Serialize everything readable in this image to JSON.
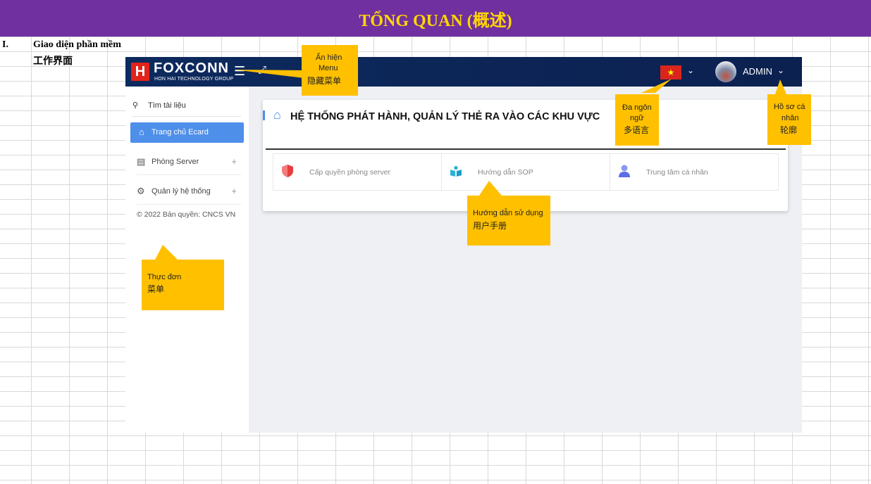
{
  "banner": {
    "title": "TỔNG QUAN (概述)"
  },
  "section": {
    "number": "I.",
    "title": "Giao diện phần mềm",
    "subtitle": "工作界面"
  },
  "app": {
    "brand": {
      "name": "FOXCONN",
      "tagline": "HON HAI TECHNOLOGY GROUP",
      "logo_letter": "H"
    },
    "topbar": {
      "menu_toggle_icon": "hamburger-icon",
      "fullscreen_icon": "expand-icon",
      "language_flag": "★",
      "user_name": "ADMIN"
    },
    "sidebar": {
      "search_label": "Tìm tài liệu",
      "items": [
        {
          "label": "Trang chủ Ecard",
          "icon": "home-icon",
          "active": true
        },
        {
          "label": "Phòng Server",
          "icon": "id-card-icon",
          "expand": "+"
        },
        {
          "label": "Quản lý hệ thống",
          "icon": "gear-icon",
          "expand": "+"
        }
      ],
      "copyright": "© 2022 Bản quyền: CNCS VN"
    },
    "main": {
      "title": "HỆ THỐNG PHÁT HÀNH, QUẢN LÝ THẺ RA VÀO CÁC KHU VỰC",
      "cards": [
        {
          "label": "Cấp quyền phòng server",
          "icon": "shield-icon"
        },
        {
          "label": "Hướng dẫn SOP",
          "icon": "book-icon"
        },
        {
          "label": "Trung tâm cá nhân",
          "icon": "user-icon"
        }
      ]
    }
  },
  "callouts": {
    "menu": {
      "line1": "Ẩn hiện",
      "line2": "Menu",
      "line3": "隐藏菜单"
    },
    "language": {
      "line1": "Đa ngôn",
      "line2": "ngữ",
      "line3": "多语言"
    },
    "profile": {
      "line1": "Hồ sơ cá",
      "line2": "nhân",
      "line3": "轮廓"
    },
    "guide": {
      "line1": "Hướng dẫn sử dụng",
      "line2": "用户手册"
    },
    "sidebar": {
      "line1": "Thực đơn",
      "line2": "菜单"
    }
  },
  "colors": {
    "banner": "#7030a0",
    "banner_text": "#ffd700",
    "callout": "#ffc000",
    "topbar": "#0d2a5e",
    "accent": "#4e8fea"
  }
}
